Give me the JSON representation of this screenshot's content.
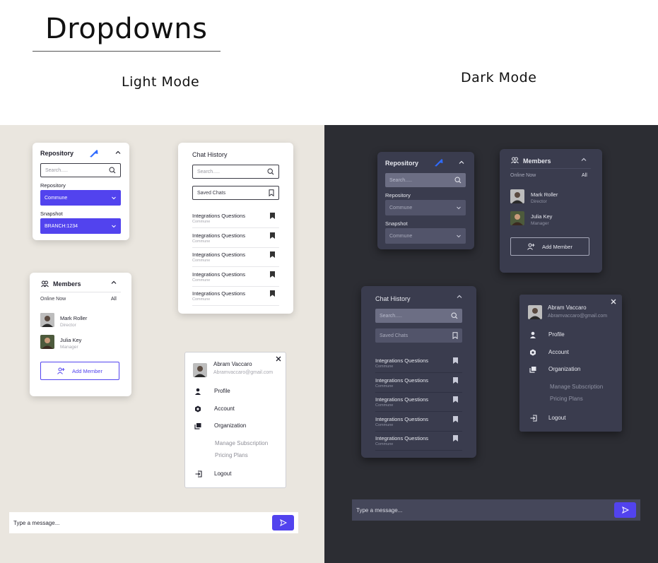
{
  "page": {
    "title": "Dropdowns",
    "light_label": "Light Mode",
    "dark_label": "Dark Mode"
  },
  "colors": {
    "accent": "#5243ee",
    "light_bg": "#eae6df",
    "dark_bg": "#2c2d33",
    "dark_card": "#3a3c4e"
  },
  "repository_card": {
    "title": "Repository",
    "logo_icon": "jira-logo-icon",
    "search_placeholder": "Search.....",
    "repo_label": "Repository",
    "repo_value": "Commune",
    "snapshot_label": "Snapshot",
    "snapshot_value_light": "BRANCH:1234",
    "snapshot_value_dark": "Commune"
  },
  "chat_history": {
    "title": "Chat History",
    "search_placeholder": "Search.....",
    "saved_label": "Saved Chats",
    "items": [
      {
        "title": "Integrations Questions",
        "sub": "Commune"
      },
      {
        "title": "Integrations Questions",
        "sub": "Commune"
      },
      {
        "title": "Integrations Questions",
        "sub": "Commune"
      },
      {
        "title": "Integrations Questions",
        "sub": "Commune"
      },
      {
        "title": "Integrations Questions",
        "sub": "Commune"
      }
    ]
  },
  "members": {
    "title": "Members",
    "online_label": "Online Now",
    "all_label": "All",
    "list": [
      {
        "name": "Mark Roller",
        "role": "Director"
      },
      {
        "name": "Julia Key",
        "role": "Manager"
      }
    ],
    "add_button": "Add Member"
  },
  "profile_menu": {
    "name": "Abram Vaccaro",
    "email": "Abramvaccaro@gmail.com",
    "profile": "Profile",
    "account": "Account",
    "organization": "Organization",
    "manage_subscription": "Manage Subscription",
    "pricing_plans": "Pricing Plans",
    "logout": "Logout"
  },
  "message_bar": {
    "placeholder": "Type a message..."
  }
}
